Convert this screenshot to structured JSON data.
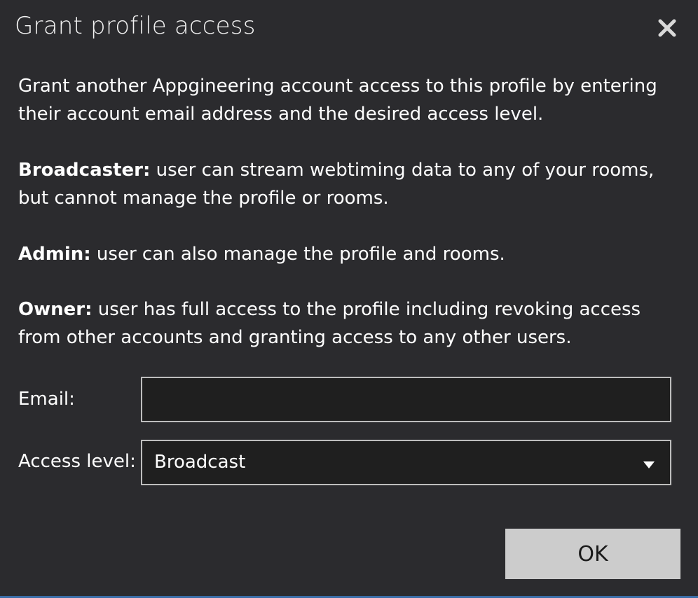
{
  "dialog": {
    "title": "Grant profile access",
    "close_icon": "close-icon"
  },
  "content": {
    "intro": "Grant another Appgineering account access to this profile by entering their account email address and the desired access level.",
    "broadcaster_label": "Broadcaster:",
    "broadcaster_text": " user can stream webtiming data to any of your rooms, but cannot manage the profile or rooms.",
    "admin_label": "Admin:",
    "admin_text": " user can also manage the profile and rooms.",
    "owner_label": "Owner:",
    "owner_text": " user has full access to the profile including revoking access from other accounts and granting access to any other users."
  },
  "form": {
    "email_label": "Email:",
    "email_value": "",
    "access_label": "Access level:",
    "access_value": "Broadcast",
    "dropdown_icon": "chevron-down-icon"
  },
  "actions": {
    "ok_label": "OK"
  },
  "colors": {
    "background": "#2b2b2e",
    "button_bg": "#cccccc",
    "accent": "#3b6ea8"
  }
}
